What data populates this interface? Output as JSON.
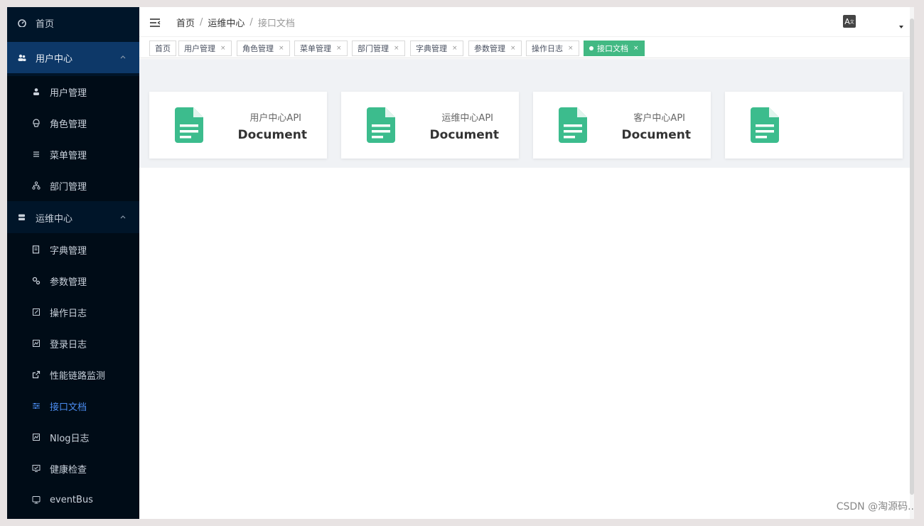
{
  "sidebar": {
    "home": "首页",
    "user_center": {
      "label": "用户中心",
      "items": [
        "用户管理",
        "角色管理",
        "菜单管理",
        "部门管理"
      ]
    },
    "ops_center": {
      "label": "运维中心",
      "items": [
        "字典管理",
        "参数管理",
        "操作日志",
        "登录日志",
        "性能链路监测",
        "接口文档",
        "Nlog日志",
        "健康检查",
        "eventBus"
      ]
    },
    "active_item": "接口文档"
  },
  "header": {
    "breadcrumb": [
      "首页",
      "运维中心",
      "接口文档"
    ],
    "lang_icon": "A"
  },
  "tags": [
    {
      "label": "首页",
      "closable": false
    },
    {
      "label": "用户管理",
      "closable": true
    },
    {
      "label": "角色管理",
      "closable": true
    },
    {
      "label": "菜单管理",
      "closable": true
    },
    {
      "label": "部门管理",
      "closable": true
    },
    {
      "label": "字典管理",
      "closable": true
    },
    {
      "label": "参数管理",
      "closable": true
    },
    {
      "label": "操作日志",
      "closable": true
    },
    {
      "label": "接口文档",
      "closable": true,
      "active": true
    }
  ],
  "cards": [
    {
      "title": "用户中心API",
      "subtitle": "Document"
    },
    {
      "title": "运维中心API",
      "subtitle": "Document"
    },
    {
      "title": "客户中心API",
      "subtitle": "Document"
    },
    {
      "title": "",
      "subtitle": ""
    }
  ],
  "watermark": "CSDN @淘源码..",
  "colors": {
    "sidebar_bg": "#001529",
    "sidebar_group_bg": "#0d3868",
    "active_text": "#4a8cf0",
    "accent": "#42b983",
    "icon_green": "#3cbc8d"
  }
}
